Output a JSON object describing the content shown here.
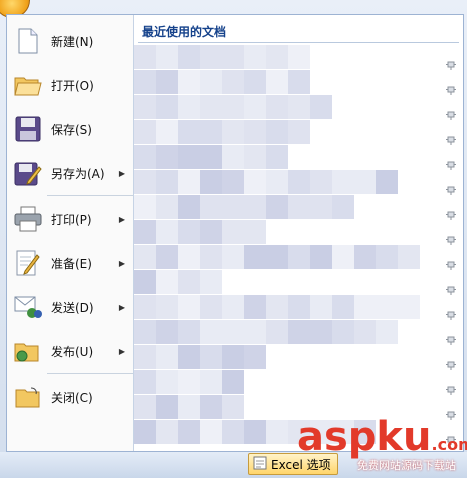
{
  "menu": {
    "items": [
      {
        "label": "新建(N)",
        "icon": "new-document-icon",
        "submenu": false
      },
      {
        "label": "打开(O)",
        "icon": "open-folder-icon",
        "submenu": false
      },
      {
        "label": "保存(S)",
        "icon": "save-disk-icon",
        "submenu": false
      },
      {
        "label": "另存为(A)",
        "icon": "save-as-icon",
        "submenu": true
      },
      {
        "label": "打印(P)",
        "icon": "printer-icon",
        "submenu": true
      },
      {
        "label": "准备(E)",
        "icon": "prepare-icon",
        "submenu": true
      },
      {
        "label": "发送(D)",
        "icon": "send-icon",
        "submenu": true
      },
      {
        "label": "发布(U)",
        "icon": "publish-icon",
        "submenu": true
      },
      {
        "label": "关闭(C)",
        "icon": "close-folder-icon",
        "submenu": false
      }
    ],
    "submenu_arrow": "▶"
  },
  "recent": {
    "title": "最近使用的文档",
    "pin_icon": "pin-icon",
    "pin_count": 16
  },
  "footer": {
    "options_label": "Excel 选项"
  },
  "watermark": {
    "main": "aspku",
    "suffix": ".com",
    "sub": "免费网站源码下载站"
  },
  "colors": {
    "accent": "#15428b",
    "watermark": "#e23a2a"
  }
}
